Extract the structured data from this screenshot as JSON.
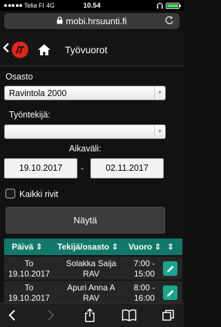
{
  "status_bar": {
    "carrier": "Telia FI",
    "network": "4G",
    "time": "10.54"
  },
  "browser": {
    "url": "mobi.hrsuunti.fi"
  },
  "header": {
    "title": "Työvuorot"
  },
  "form": {
    "department_label": "Osasto",
    "department_value": "Ravintola 2000",
    "employee_label": "Työntekijä:",
    "employee_value": "",
    "interval_label": "Aikaväli:",
    "date_from": "19.10.2017",
    "date_separator": "-",
    "date_to": "02.11.2017",
    "all_rows_label": "Kaikki rivit",
    "all_rows_checked": false,
    "show_button_label": "Näytä"
  },
  "table": {
    "columns": [
      {
        "label": "Päivä ⇕"
      },
      {
        "label": "Tekijä/osasto ⇕"
      },
      {
        "label": "Vuoro ⇕"
      },
      {
        "label": "⇕"
      }
    ],
    "rows": [
      {
        "day": "To",
        "date": "19.10.2017",
        "employee": "Solakka Saija",
        "dept": "RAV",
        "start": "7:00 -",
        "end": "15:00"
      },
      {
        "day": "To",
        "date": "19.10.2017",
        "employee": "Apuri Anna A",
        "dept": "RAV",
        "start": "8:00 -",
        "end": "16:00"
      }
    ]
  },
  "colors": {
    "table_header": "#11786a",
    "edit_button": "#1aa58c",
    "logo": "#e2231a"
  }
}
